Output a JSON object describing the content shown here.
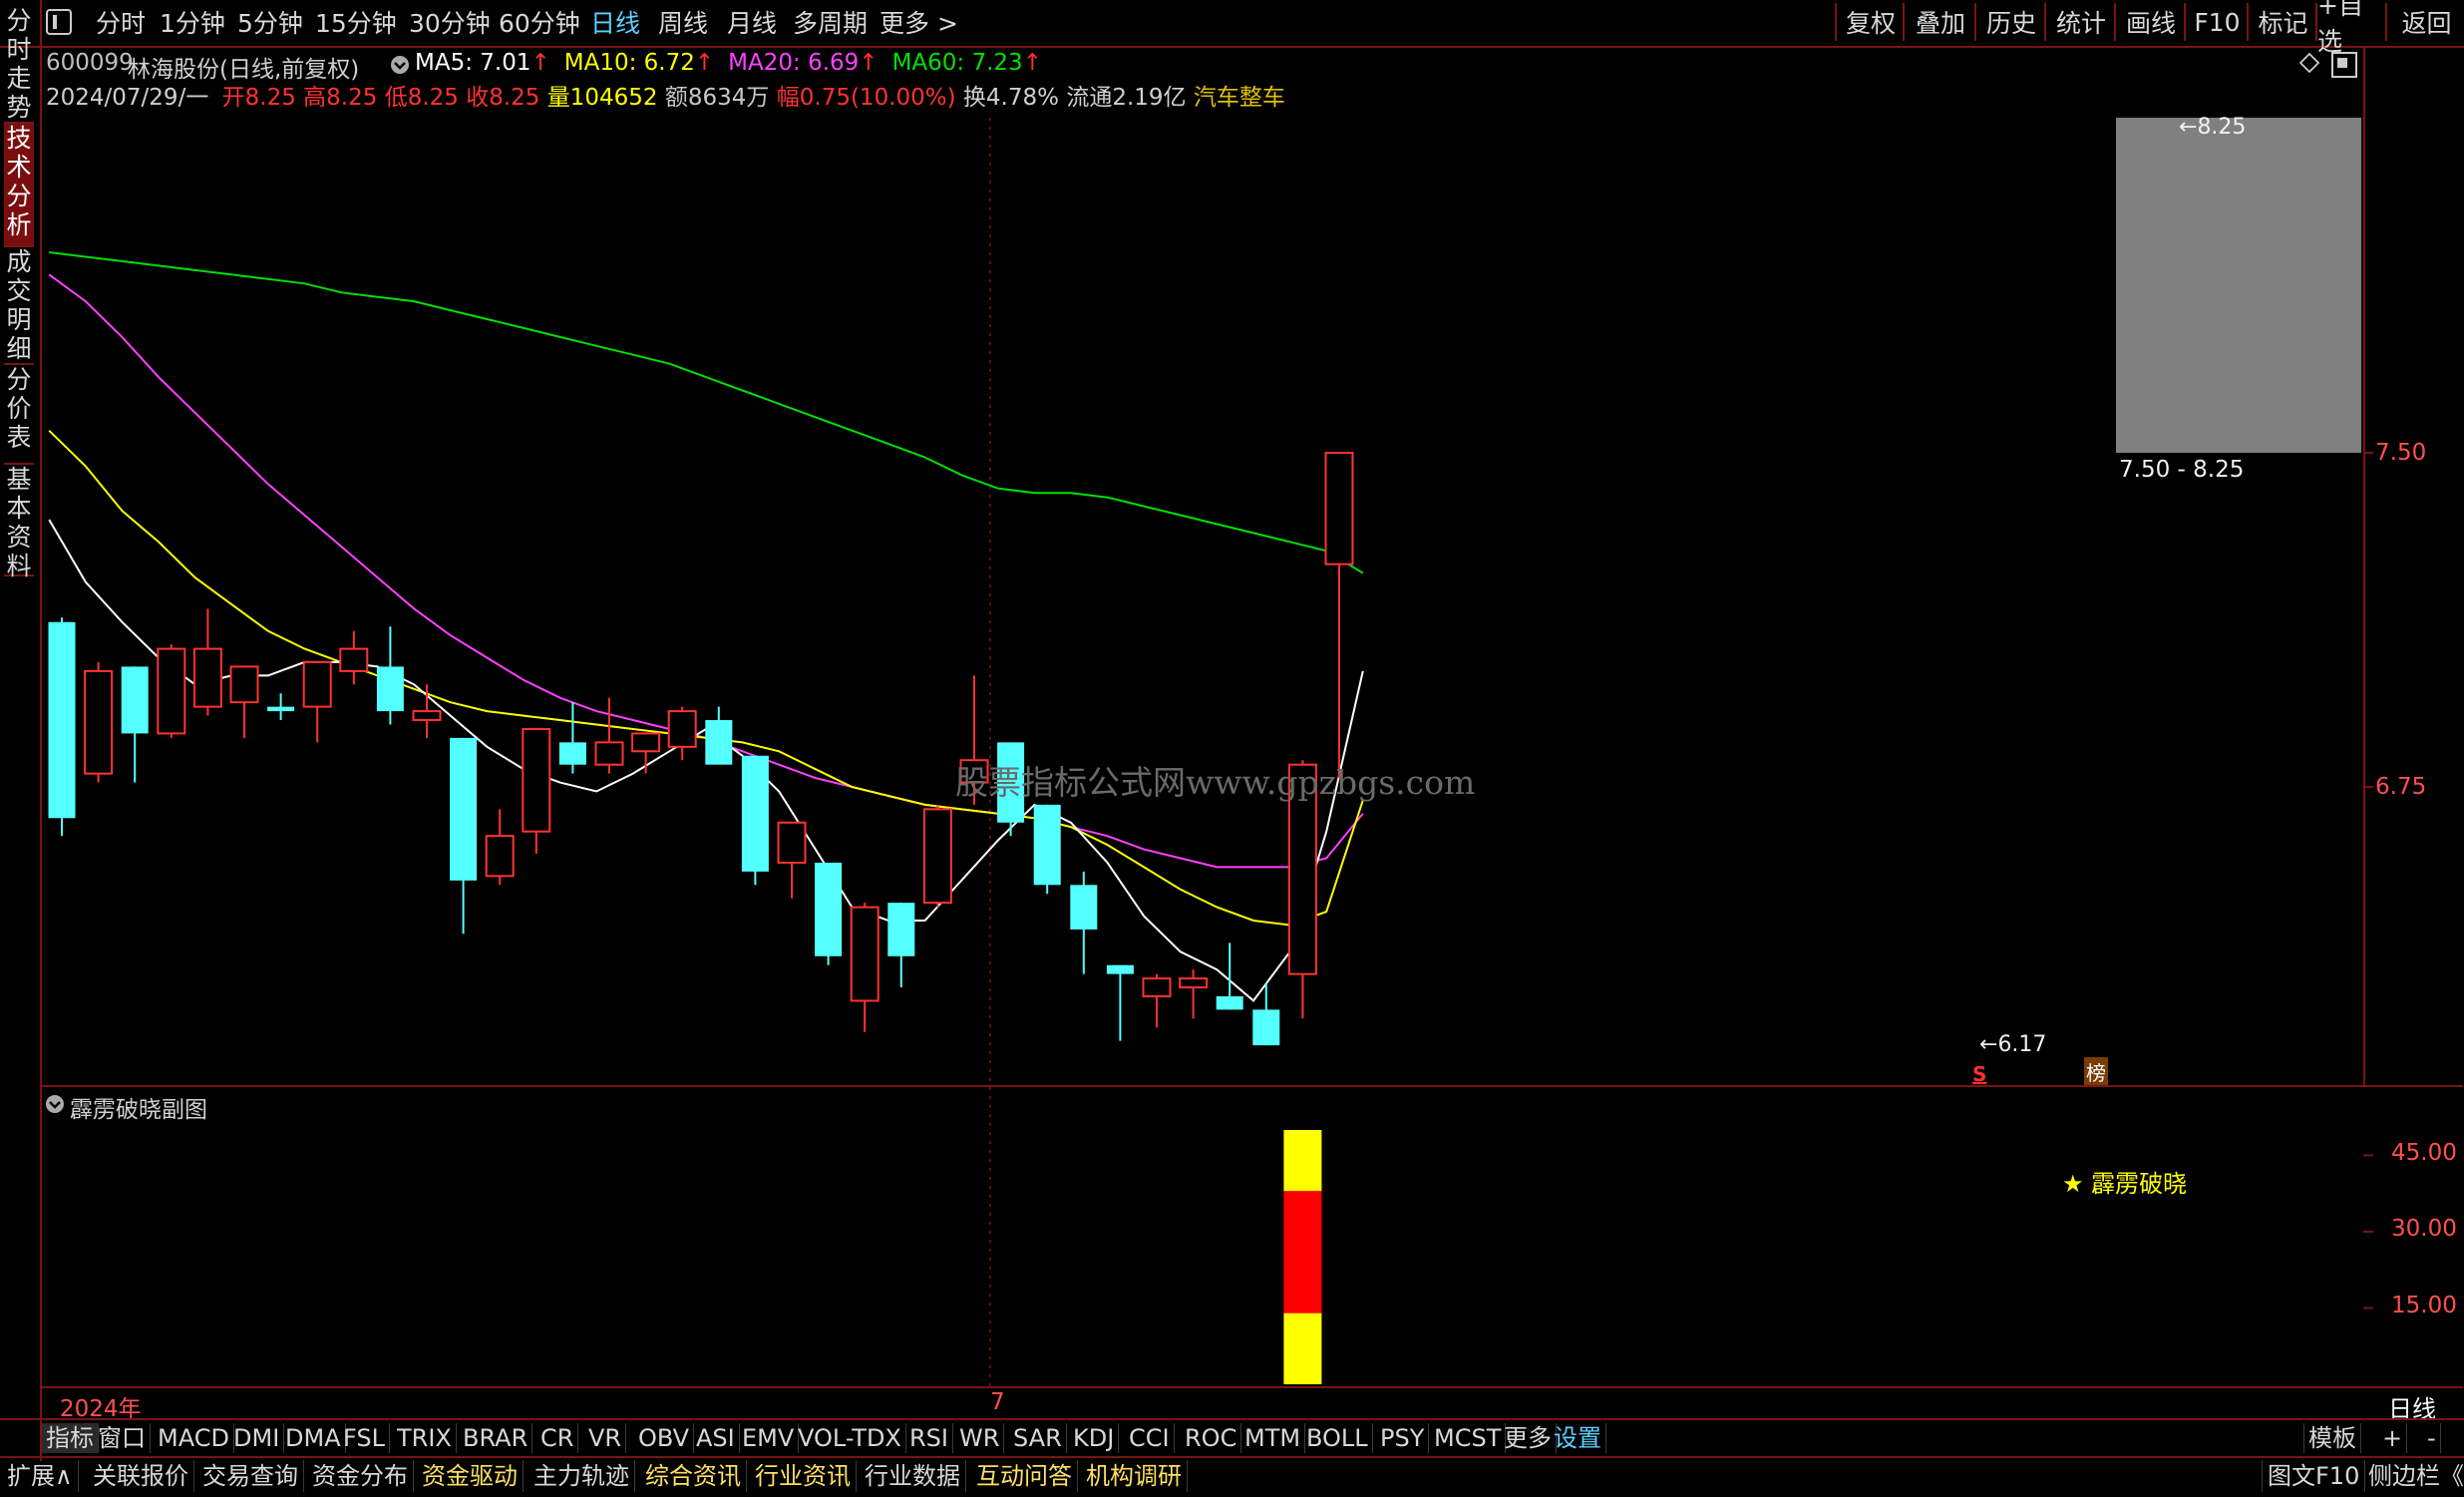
{
  "topbar": {
    "tabs": [
      "分时",
      "1分钟",
      "5分钟",
      "15分钟",
      "30分钟",
      "60分钟",
      "日线",
      "周线",
      "月线",
      "多周期",
      "更多 >"
    ],
    "active_tab": "日线",
    "right_buttons": [
      "复权",
      "叠加",
      "历史",
      "统计",
      "画线",
      "F10",
      "标记",
      "+自选",
      "返回"
    ]
  },
  "sidebar": {
    "tabs": [
      "分时走势",
      "技术分析",
      "成交明细",
      "分价表",
      "基本资料"
    ],
    "active": "技术分析"
  },
  "header": {
    "code": "600099",
    "name": "林海股份(日线,前复权)",
    "ma": [
      {
        "label": "MA5: 7.01",
        "color": "#ffffff"
      },
      {
        "label": "MA10: 6.72",
        "color": "#ffff00"
      },
      {
        "label": "MA20: 6.69",
        "color": "#ff40ff"
      },
      {
        "label": "MA60: 7.23",
        "color": "#00e000"
      }
    ],
    "arrow": "↑",
    "date": "2024/07/29/一",
    "open_label": "开8.25",
    "high_label": "高8.25",
    "low_label": "低8.25",
    "close_label": "收8.25",
    "vol_prefix": "量",
    "vol_value": "104652",
    "amt_prefix": "额",
    "amt_value": "8634万",
    "chg_label": "幅0.75(10.00%)",
    "turnover": "换4.78%",
    "float_shares": "流通2.19亿",
    "industry": "汽车整车"
  },
  "main_axis": [
    "7.50",
    "6.75"
  ],
  "annotations": {
    "high_mark": "8.25",
    "range_mark": "7.50 - 8.25",
    "low_mark": "6.17",
    "signal_s": "S",
    "signal_bang": "榜",
    "watermark": "股票指标公式网www.gpzbgs.com"
  },
  "sub_chart": {
    "title": "霹雳破晓副图",
    "legend": "★ 霹雳破晓",
    "axis": [
      "45.00",
      "30.00",
      "15.00"
    ]
  },
  "time_axis": {
    "year": "2024年",
    "month": "7",
    "period_label": "日线"
  },
  "indicator_tabs": [
    "指标",
    "窗口",
    "MACD",
    "DMI",
    "DMA",
    "FSL",
    "TRIX",
    "BRAR",
    "CR",
    "VR",
    "OBV",
    "ASI",
    "EMV",
    "VOL-TDX",
    "RSI",
    "WR",
    "SAR",
    "KDJ",
    "CCI",
    "ROC",
    "MTM",
    "BOLL",
    "PSY",
    "MCST",
    "更多",
    "设置"
  ],
  "indicator_right": {
    "template": "模板",
    "plus": "+",
    "minus": "-"
  },
  "bottom_tabs": [
    "扩展∧",
    "关联报价",
    "交易查询",
    "资金分布",
    "资金驱动",
    "主力轨迹",
    "综合资讯",
    "行业资讯",
    "行业数据",
    "互动问答",
    "机构调研"
  ],
  "bottom_right": [
    "图文F10",
    "侧边栏《"
  ],
  "colors": {
    "up": "#ff3232",
    "down": "#54ffff",
    "ma5": "#ffffff",
    "ma10": "#ffff00",
    "ma20": "#ff40ff",
    "ma60": "#00e000",
    "frame": "#7a1414"
  },
  "chart_data": {
    "type": "candlestick",
    "y_axis_ticks": [
      7.5,
      6.75
    ],
    "candles": [
      {
        "o": 7.12,
        "h": 7.13,
        "l": 6.64,
        "c": 6.68
      },
      {
        "o": 6.78,
        "h": 7.03,
        "l": 6.76,
        "c": 7.01
      },
      {
        "o": 7.02,
        "h": 7.02,
        "l": 6.76,
        "c": 6.87
      },
      {
        "o": 6.87,
        "h": 7.07,
        "l": 6.86,
        "c": 7.06
      },
      {
        "o": 6.93,
        "h": 7.15,
        "l": 6.91,
        "c": 7.06
      },
      {
        "o": 6.94,
        "h": 7.02,
        "l": 6.86,
        "c": 7.02
      },
      {
        "o": 6.93,
        "h": 6.96,
        "l": 6.9,
        "c": 6.92
      },
      {
        "o": 6.93,
        "h": 7.03,
        "l": 6.85,
        "c": 7.03
      },
      {
        "o": 7.01,
        "h": 7.1,
        "l": 6.98,
        "c": 7.06
      },
      {
        "o": 7.02,
        "h": 7.11,
        "l": 6.89,
        "c": 6.92
      },
      {
        "o": 6.9,
        "h": 6.98,
        "l": 6.86,
        "c": 6.92
      },
      {
        "o": 6.86,
        "h": 6.86,
        "l": 6.42,
        "c": 6.54
      },
      {
        "o": 6.55,
        "h": 6.7,
        "l": 6.53,
        "c": 6.64
      },
      {
        "o": 6.65,
        "h": 6.88,
        "l": 6.6,
        "c": 6.88
      },
      {
        "o": 6.85,
        "h": 6.94,
        "l": 6.78,
        "c": 6.8
      },
      {
        "o": 6.8,
        "h": 6.95,
        "l": 6.78,
        "c": 6.85
      },
      {
        "o": 6.83,
        "h": 6.83,
        "l": 6.78,
        "c": 6.87
      },
      {
        "o": 6.84,
        "h": 6.93,
        "l": 6.81,
        "c": 6.92
      },
      {
        "o": 6.9,
        "h": 6.93,
        "l": 6.82,
        "c": 6.8
      },
      {
        "o": 6.82,
        "h": 6.82,
        "l": 6.53,
        "c": 6.56
      },
      {
        "o": 6.58,
        "h": 6.67,
        "l": 6.5,
        "c": 6.67
      },
      {
        "o": 6.58,
        "h": 6.58,
        "l": 6.35,
        "c": 6.37
      },
      {
        "o": 6.27,
        "h": 6.49,
        "l": 6.2,
        "c": 6.48
      },
      {
        "o": 6.49,
        "h": 6.49,
        "l": 6.3,
        "c": 6.37
      },
      {
        "o": 6.49,
        "h": 6.71,
        "l": 6.48,
        "c": 6.7
      },
      {
        "o": 6.76,
        "h": 7.0,
        "l": 6.71,
        "c": 6.81
      },
      {
        "o": 6.85,
        "h": 6.85,
        "l": 6.64,
        "c": 6.67
      },
      {
        "o": 6.71,
        "h": 6.71,
        "l": 6.51,
        "c": 6.53
      },
      {
        "o": 6.53,
        "h": 6.56,
        "l": 6.33,
        "c": 6.43
      },
      {
        "o": 6.35,
        "h": 6.35,
        "l": 6.18,
        "c": 6.33
      },
      {
        "o": 6.28,
        "h": 6.33,
        "l": 6.21,
        "c": 6.32
      },
      {
        "o": 6.3,
        "h": 6.34,
        "l": 6.23,
        "c": 6.32
      },
      {
        "o": 6.28,
        "h": 6.4,
        "l": 6.25,
        "c": 6.25
      },
      {
        "o": 6.25,
        "h": 6.31,
        "l": 6.17,
        "c": 6.17
      },
      {
        "o": 6.33,
        "h": 6.81,
        "l": 6.23,
        "c": 6.8
      },
      {
        "o": 7.25,
        "h": 7.5,
        "l": 6.77,
        "c": 7.5
      }
    ],
    "ma5": [
      7.35,
      7.21,
      7.12,
      7.04,
      6.98,
      7.0,
      7.0,
      7.03,
      7.03,
      7.02,
      6.98,
      6.91,
      6.84,
      6.79,
      6.76,
      6.74,
      6.78,
      6.83,
      6.88,
      6.82,
      6.74,
      6.61,
      6.48,
      6.45,
      6.45,
      6.54,
      6.63,
      6.71,
      6.67,
      6.58,
      6.46,
      6.38,
      6.34,
      6.27,
      6.38,
      6.65,
      7.01
    ],
    "ma10": [
      7.55,
      7.47,
      7.37,
      7.3,
      7.22,
      7.16,
      7.1,
      7.06,
      7.03,
      7.0,
      6.97,
      6.94,
      6.92,
      6.91,
      6.9,
      6.89,
      6.88,
      6.87,
      6.86,
      6.85,
      6.83,
      6.79,
      6.75,
      6.73,
      6.71,
      6.7,
      6.69,
      6.68,
      6.66,
      6.62,
      6.57,
      6.52,
      6.48,
      6.45,
      6.44,
      6.47,
      6.72
    ],
    "ma20": [
      7.9,
      7.84,
      7.76,
      7.67,
      7.59,
      7.51,
      7.43,
      7.36,
      7.29,
      7.22,
      7.15,
      7.09,
      7.04,
      6.99,
      6.95,
      6.92,
      6.9,
      6.88,
      6.86,
      6.83,
      6.8,
      6.77,
      6.75,
      6.73,
      6.71,
      6.7,
      6.69,
      6.68,
      6.66,
      6.64,
      6.61,
      6.59,
      6.57,
      6.57,
      6.57,
      6.59,
      6.69
    ],
    "ma60": [
      7.95,
      7.94,
      7.93,
      7.92,
      7.91,
      7.9,
      7.89,
      7.88,
      7.86,
      7.85,
      7.84,
      7.82,
      7.8,
      7.78,
      7.76,
      7.74,
      7.72,
      7.7,
      7.67,
      7.64,
      7.61,
      7.58,
      7.55,
      7.52,
      7.49,
      7.45,
      7.42,
      7.41,
      7.41,
      7.4,
      7.38,
      7.36,
      7.34,
      7.32,
      7.3,
      7.28,
      7.23
    ],
    "sub_series": [
      {
        "name": "霹雳破晓",
        "bar_index": 34,
        "segments": [
          {
            "from": 0,
            "to": 14,
            "color": "#ffff00"
          },
          {
            "from": 14,
            "to": 38,
            "color": "#ff0000"
          },
          {
            "from": 38,
            "to": 50,
            "color": "#ffff00"
          }
        ]
      }
    ],
    "sub_y_ticks": [
      45,
      30,
      15
    ]
  }
}
